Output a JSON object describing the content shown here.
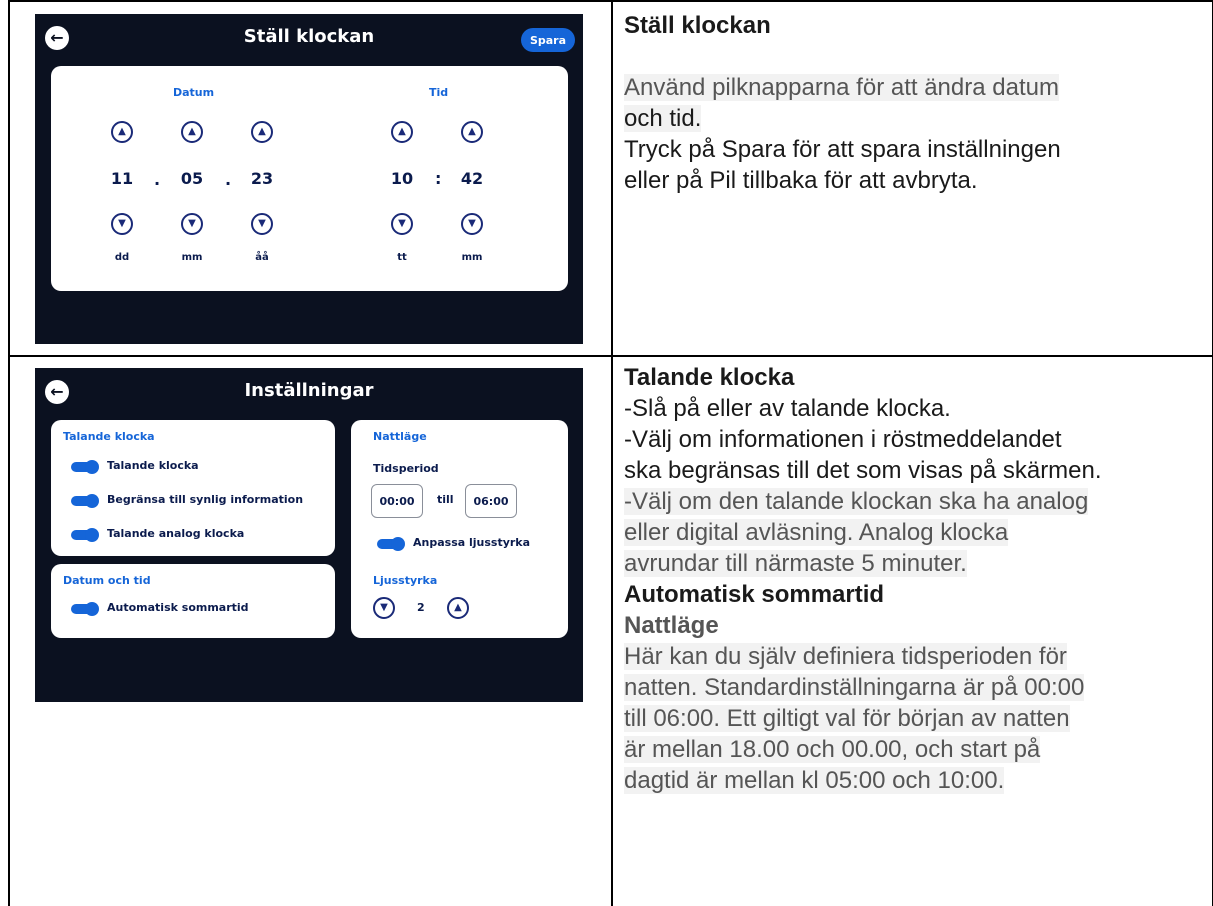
{
  "screen1": {
    "title": "Ställ klockan",
    "save_label": "Spara",
    "date_label": "Datum",
    "time_label": "Tid",
    "date_values": [
      "11",
      "05",
      "23"
    ],
    "time_values": [
      "10",
      "42"
    ],
    "date_separator": ".",
    "time_separator": ":",
    "date_units": [
      "dd",
      "mm",
      "åå"
    ],
    "time_units": [
      "tt",
      "mm"
    ]
  },
  "screen2": {
    "title": "Inställningar",
    "talande_card": {
      "title": "Talande klocka",
      "items": [
        "Talande klocka",
        "Begränsa till synlig information",
        "Talande analog klocka"
      ]
    },
    "datum_card": {
      "title": "Datum och tid",
      "items": [
        "Automatisk sommartid"
      ]
    },
    "natt_card": {
      "title": "Nattläge",
      "period_label": "Tidsperiod",
      "start": "00:00",
      "till": "till",
      "end": "06:00",
      "adapt_label": "Anpassa ljusstyrka",
      "brightness_label": "Ljusstyrka",
      "brightness_value": "2"
    }
  },
  "text1": {
    "heading": "Ställ klockan",
    "line1": "Använd pilknapparna för att ändra datum",
    "line2": "och tid.",
    "line3": "Tryck på Spara för att spara inställningen",
    "line4": "eller på Pil tillbaka för att avbryta."
  },
  "text2": {
    "heading1": "Talande klocka",
    "l1": "-Slå på eller av talande klocka.",
    "l2": "-Välj om informationen i röstmeddelandet",
    "l3": "ska begränsas till det som visas på skärmen.",
    "l4": "-Välj om den talande klockan ska ha analog",
    "l5": "eller digital avläsning. Analog klocka",
    "l6": "avrundar till närmaste 5 minuter.",
    "heading2": "Automatisk sommartid",
    "heading3": "Nattläge",
    "l7": "Här kan du själv definiera tidsperioden för",
    "l8": "natten. Standardinställningarna är på 00:00",
    "l9": "till 06:00. Ett giltigt val för början av natten",
    "l10": "är mellan 18.00 och 00.00, och start på",
    "l11": "dagtid är mellan kl 05:00 och 10:00."
  },
  "icons": {
    "back": "arrow-left-icon",
    "up": "chevron-up-icon",
    "down": "chevron-down-icon",
    "toggle": "toggle-on-icon"
  },
  "colors": {
    "screen_bg": "#0b1120",
    "accent": "#1565d8",
    "dark_text": "#0b1b4d"
  }
}
